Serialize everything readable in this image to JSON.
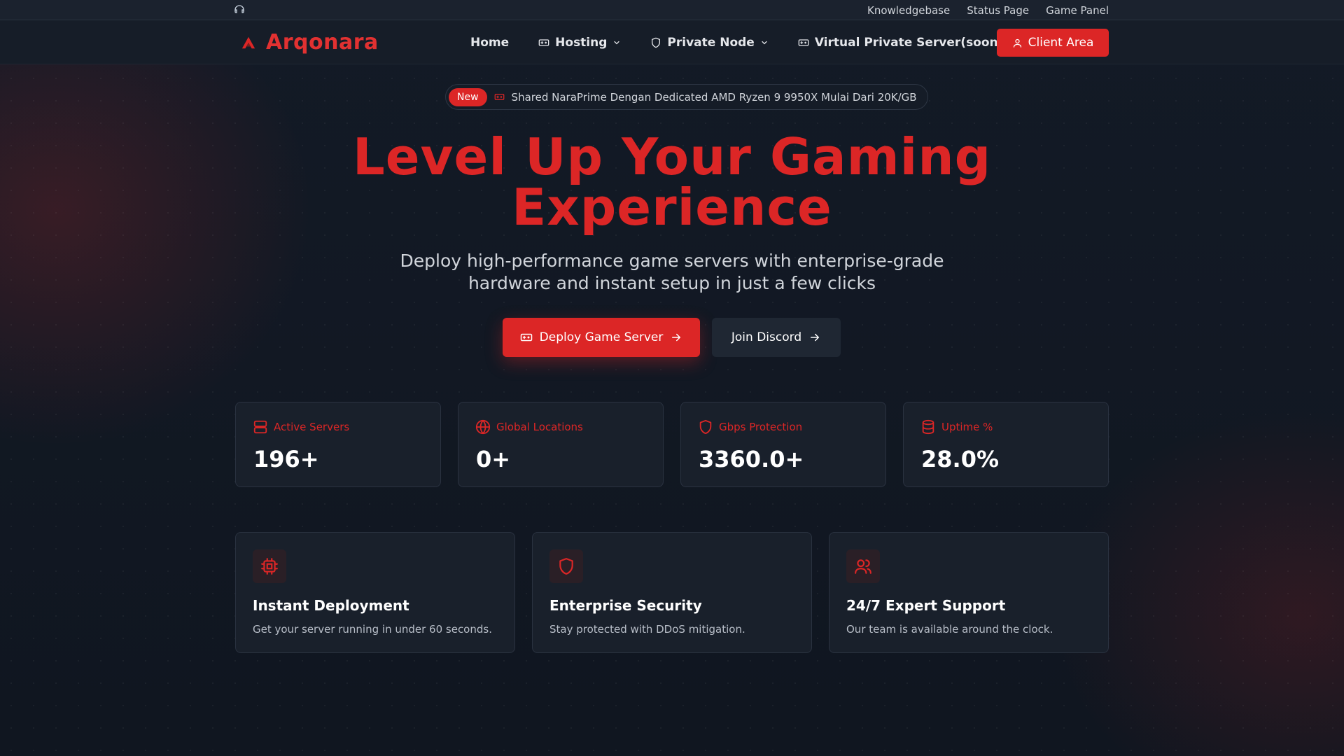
{
  "topbar": {
    "links": [
      "Knowledgebase",
      "Status Page",
      "Game Panel"
    ]
  },
  "nav": {
    "brand": "Arqonara",
    "items": [
      {
        "label": "Home"
      },
      {
        "label": "Hosting"
      },
      {
        "label": "Private Node"
      },
      {
        "label": "Virtual Private Server(soon)"
      }
    ],
    "client_area": "Client Area"
  },
  "announcement": {
    "badge": "New",
    "text": "Shared NaraPrime Dengan Dedicated AMD Ryzen 9 9950X Mulai Dari 20K/GB"
  },
  "hero": {
    "title_line1": "Level Up Your Gaming",
    "title_line2": "Experience",
    "subtitle_line1": "Deploy high-performance game servers with enterprise-grade",
    "subtitle_line2": "hardware and instant setup in just a few clicks",
    "primary_button": "Deploy Game Server",
    "secondary_button": "Join Discord"
  },
  "stats": [
    {
      "label": "Active Servers",
      "value": "196+",
      "icon": "server-icon"
    },
    {
      "label": "Global Locations",
      "value": "0+",
      "icon": "globe-icon"
    },
    {
      "label": "Gbps Protection",
      "value": "3360.0+",
      "icon": "shield-icon"
    },
    {
      "label": "Uptime %",
      "value": "28.0%",
      "icon": "database-icon"
    }
  ],
  "features": [
    {
      "title": "Instant Deployment",
      "desc": "Get your server running in under 60 seconds.",
      "icon": "cpu-icon"
    },
    {
      "title": "Enterprise Security",
      "desc": "Stay protected with DDoS mitigation.",
      "icon": "shield-icon"
    },
    {
      "title": "24/7 Expert Support",
      "desc": "Our team is available around the clock.",
      "icon": "users-icon"
    }
  ],
  "colors": {
    "accent": "#dc2626",
    "background": "#111722",
    "card": "#19202b"
  }
}
